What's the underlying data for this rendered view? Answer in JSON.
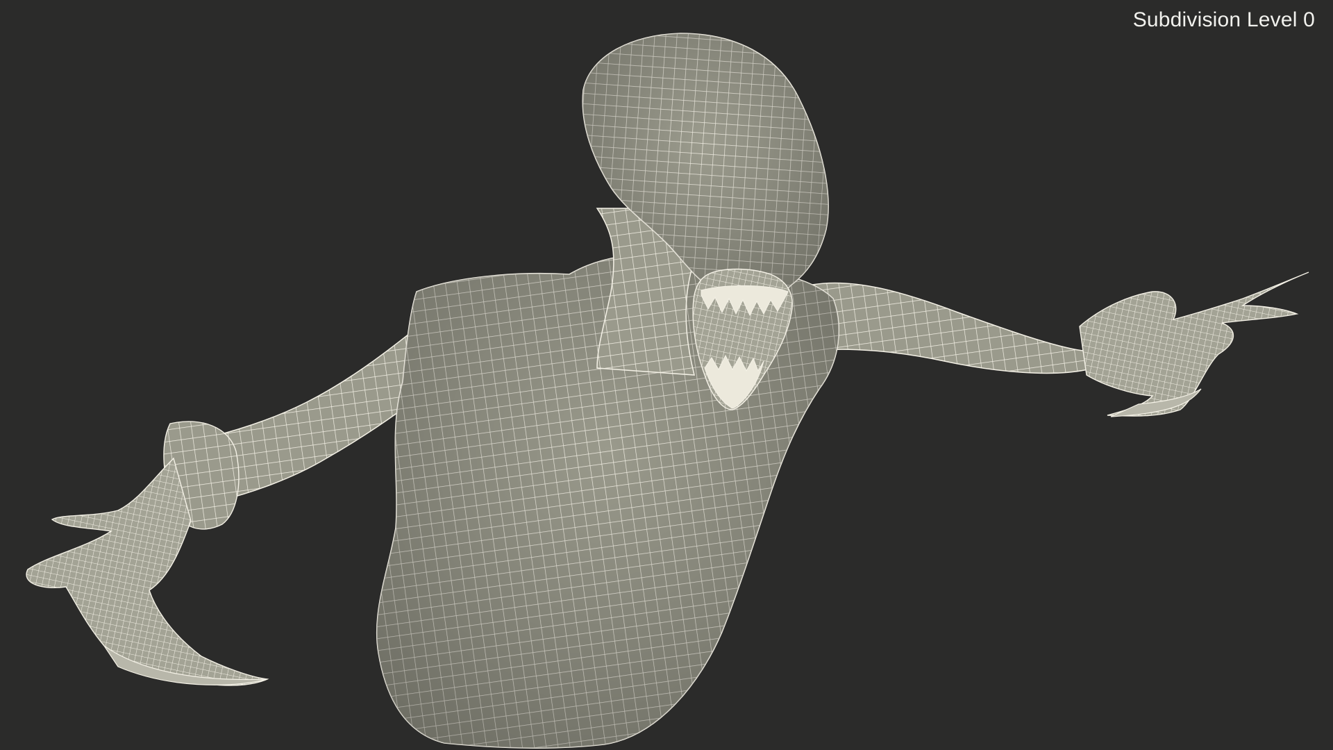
{
  "viewport": {
    "label": "Subdivision Level 0",
    "background": "#2b2b2a",
    "mesh_fill": "#9a9a8c",
    "mesh_wire": "#f4f1e6"
  },
  "model": {
    "icon": "wireframe-creature-model"
  }
}
